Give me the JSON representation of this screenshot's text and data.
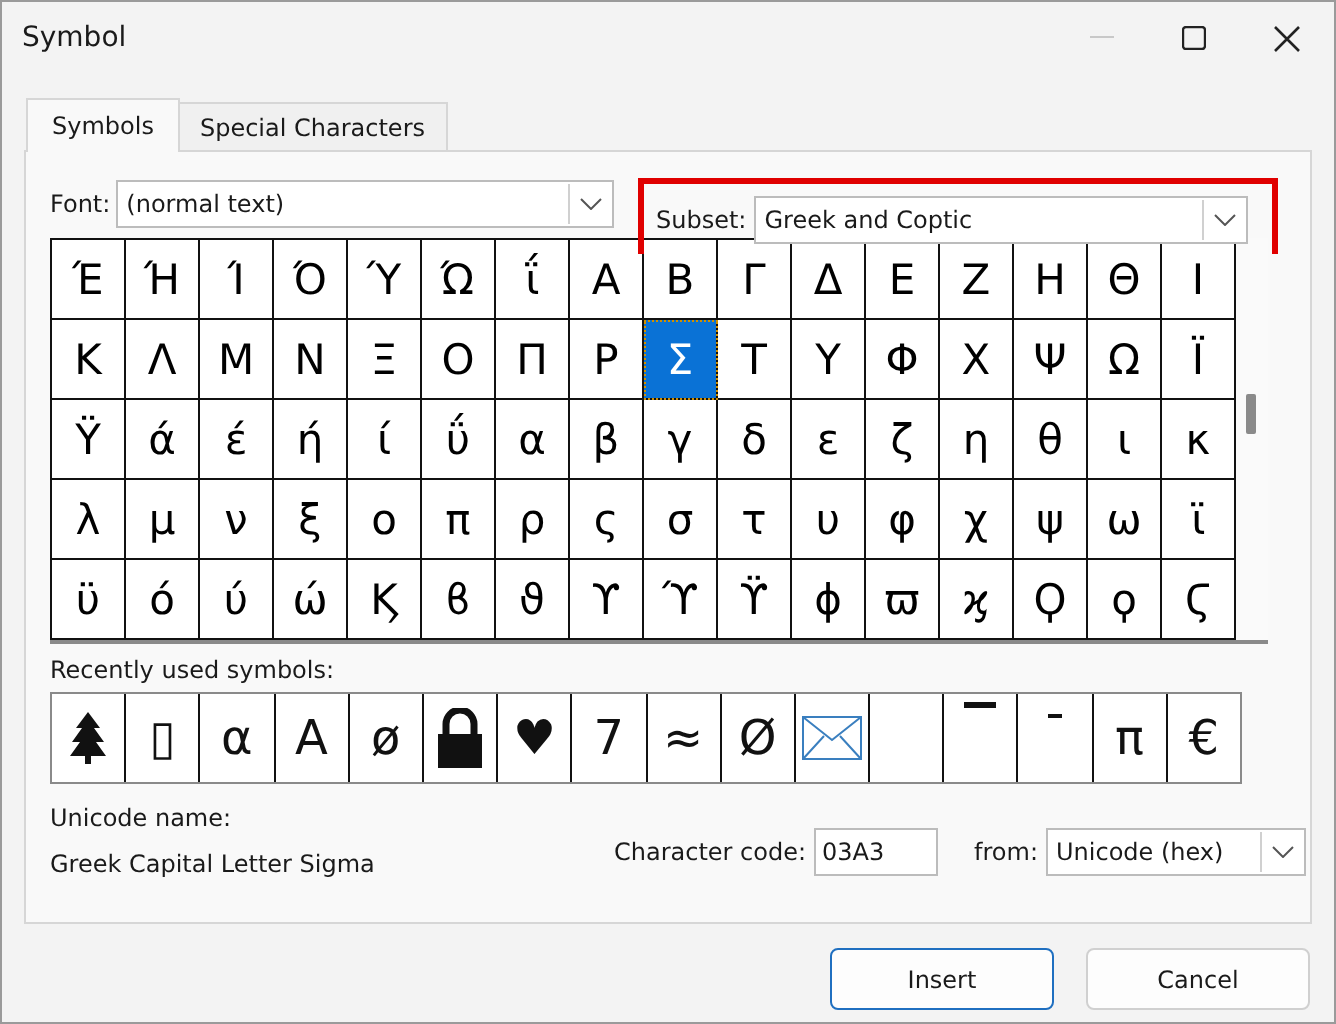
{
  "window": {
    "title": "Symbol"
  },
  "tabs": [
    {
      "label": "Symbols",
      "selected": true
    },
    {
      "label": "Special Characters",
      "selected": false
    }
  ],
  "font": {
    "label": "Font:",
    "value": "(normal text)"
  },
  "subset": {
    "label": "Subset:",
    "value": "Greek and Coptic",
    "highlighted": true
  },
  "grid": {
    "rows": [
      [
        {
          "char": "Έ",
          "selected": false
        },
        {
          "char": "Ή",
          "selected": false
        },
        {
          "char": "Ί",
          "selected": false
        },
        {
          "char": "Ό",
          "selected": false
        },
        {
          "char": "Ύ",
          "selected": false
        },
        {
          "char": "Ώ",
          "selected": false
        },
        {
          "char": "ΐ",
          "selected": false
        },
        {
          "char": "Α",
          "selected": false
        },
        {
          "char": "Β",
          "selected": false
        },
        {
          "char": "Γ",
          "selected": false
        },
        {
          "char": "Δ",
          "selected": false
        },
        {
          "char": "Ε",
          "selected": false
        },
        {
          "char": "Ζ",
          "selected": false
        },
        {
          "char": "Η",
          "selected": false
        },
        {
          "char": "Θ",
          "selected": false
        },
        {
          "char": "Ι",
          "selected": false
        }
      ],
      [
        {
          "char": "Κ",
          "selected": false
        },
        {
          "char": "Λ",
          "selected": false
        },
        {
          "char": "Μ",
          "selected": false
        },
        {
          "char": "Ν",
          "selected": false
        },
        {
          "char": "Ξ",
          "selected": false
        },
        {
          "char": "Ο",
          "selected": false
        },
        {
          "char": "Π",
          "selected": false
        },
        {
          "char": "Ρ",
          "selected": false
        },
        {
          "char": "Σ",
          "selected": true
        },
        {
          "char": "Τ",
          "selected": false
        },
        {
          "char": "Υ",
          "selected": false
        },
        {
          "char": "Φ",
          "selected": false
        },
        {
          "char": "Χ",
          "selected": false
        },
        {
          "char": "Ψ",
          "selected": false
        },
        {
          "char": "Ω",
          "selected": false
        },
        {
          "char": "Ϊ",
          "selected": false
        }
      ],
      [
        {
          "char": "Ϋ",
          "selected": false
        },
        {
          "char": "ά",
          "selected": false
        },
        {
          "char": "έ",
          "selected": false
        },
        {
          "char": "ή",
          "selected": false
        },
        {
          "char": "ί",
          "selected": false
        },
        {
          "char": "ΰ",
          "selected": false
        },
        {
          "char": "α",
          "selected": false
        },
        {
          "char": "β",
          "selected": false
        },
        {
          "char": "γ",
          "selected": false
        },
        {
          "char": "δ",
          "selected": false
        },
        {
          "char": "ε",
          "selected": false
        },
        {
          "char": "ζ",
          "selected": false
        },
        {
          "char": "η",
          "selected": false
        },
        {
          "char": "θ",
          "selected": false
        },
        {
          "char": "ι",
          "selected": false
        },
        {
          "char": "κ",
          "selected": false
        }
      ],
      [
        {
          "char": "λ",
          "selected": false
        },
        {
          "char": "μ",
          "selected": false
        },
        {
          "char": "ν",
          "selected": false
        },
        {
          "char": "ξ",
          "selected": false
        },
        {
          "char": "ο",
          "selected": false
        },
        {
          "char": "π",
          "selected": false
        },
        {
          "char": "ρ",
          "selected": false
        },
        {
          "char": "ς",
          "selected": false
        },
        {
          "char": "σ",
          "selected": false
        },
        {
          "char": "τ",
          "selected": false
        },
        {
          "char": "υ",
          "selected": false
        },
        {
          "char": "φ",
          "selected": false
        },
        {
          "char": "χ",
          "selected": false
        },
        {
          "char": "ψ",
          "selected": false
        },
        {
          "char": "ω",
          "selected": false
        },
        {
          "char": "ϊ",
          "selected": false
        }
      ],
      [
        {
          "char": "ϋ",
          "selected": false
        },
        {
          "char": "ό",
          "selected": false
        },
        {
          "char": "ύ",
          "selected": false
        },
        {
          "char": "ώ",
          "selected": false
        },
        {
          "char": "Ϗ",
          "selected": false
        },
        {
          "char": "ϐ",
          "selected": false
        },
        {
          "char": "ϑ",
          "selected": false
        },
        {
          "char": "ϒ",
          "selected": false
        },
        {
          "char": "ϓ",
          "selected": false
        },
        {
          "char": "ϔ",
          "selected": false
        },
        {
          "char": "ϕ",
          "selected": false
        },
        {
          "char": "ϖ",
          "selected": false
        },
        {
          "char": "ϗ",
          "selected": false
        },
        {
          "char": "Ϙ",
          "selected": false
        },
        {
          "char": "ϙ",
          "selected": false
        },
        {
          "char": "Ϛ",
          "selected": false
        }
      ]
    ]
  },
  "recent": {
    "label": "Recently used symbols:",
    "items": [
      {
        "kind": "tree"
      },
      {
        "kind": "glyph",
        "char": "▯"
      },
      {
        "kind": "glyph",
        "char": "α"
      },
      {
        "kind": "glyph",
        "char": "A"
      },
      {
        "kind": "glyph",
        "char": "ø"
      },
      {
        "kind": "lock"
      },
      {
        "kind": "glyph",
        "char": "♥"
      },
      {
        "kind": "glyph",
        "char": "7"
      },
      {
        "kind": "glyph",
        "char": "≈"
      },
      {
        "kind": "glyph",
        "char": "Ø"
      },
      {
        "kind": "envelope"
      },
      {
        "kind": "empty"
      },
      {
        "kind": "bar"
      },
      {
        "kind": "dash"
      },
      {
        "kind": "glyph",
        "char": "π"
      },
      {
        "kind": "glyph",
        "char": "€"
      }
    ]
  },
  "unicode_name": {
    "label": "Unicode name:",
    "value": "Greek Capital Letter Sigma"
  },
  "character_code": {
    "label": "Character code:",
    "value": "03A3"
  },
  "from": {
    "label": "from:",
    "value": "Unicode (hex)"
  },
  "buttons": [
    {
      "label": "Insert",
      "default": true
    },
    {
      "label": "Cancel",
      "default": false
    }
  ]
}
